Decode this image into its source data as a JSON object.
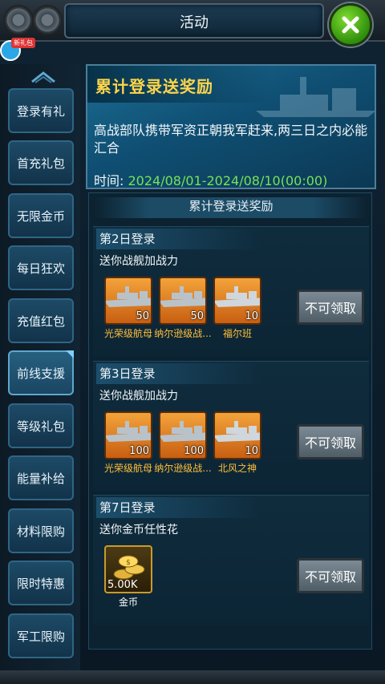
{
  "header": {
    "title": "活动"
  },
  "gift_tag": "新礼包",
  "sidebar": {
    "items": [
      {
        "label": "登录有礼"
      },
      {
        "label": "首充礼包"
      },
      {
        "label": "无限金币"
      },
      {
        "label": "每日狂欢"
      },
      {
        "label": "充值红包"
      },
      {
        "label": "前线支援",
        "active": true
      },
      {
        "label": "等级礼包"
      },
      {
        "label": "能量补给"
      },
      {
        "label": "材料限购"
      },
      {
        "label": "限时特惠"
      },
      {
        "label": "军工限购"
      }
    ]
  },
  "banner": {
    "title": "累计登录送奖励",
    "description": "高战部队携带军资正朝我军赶来,两三日之内必能汇合",
    "time_label": "时间:",
    "time_value": "2024/08/01-2024/08/10(00:00)"
  },
  "list": {
    "header": "累计登录送奖励",
    "sections": [
      {
        "title": "第2日登录",
        "subtitle": "送你战舰加战力",
        "button": "不可领取",
        "rewards": [
          {
            "name": "光荣级航母",
            "count": "50"
          },
          {
            "name": "纳尔逊级战...",
            "count": "50"
          },
          {
            "name": "福尔班",
            "count": "10"
          }
        ]
      },
      {
        "title": "第3日登录",
        "subtitle": "送你战舰加战力",
        "button": "不可领取",
        "rewards": [
          {
            "name": "光荣级航母",
            "count": "100"
          },
          {
            "name": "纳尔逊级战...",
            "count": "100"
          },
          {
            "name": "北风之神",
            "count": "10"
          }
        ]
      },
      {
        "title": "第7日登录",
        "subtitle": "送你金币任性花",
        "button": "不可领取",
        "rewards": [
          {
            "name": "金币",
            "count": "5.00K"
          }
        ]
      }
    ]
  },
  "colors": {
    "accent_gold": "#ffd54a",
    "time_green": "#77e257",
    "item_orange": "#f3a33a"
  }
}
